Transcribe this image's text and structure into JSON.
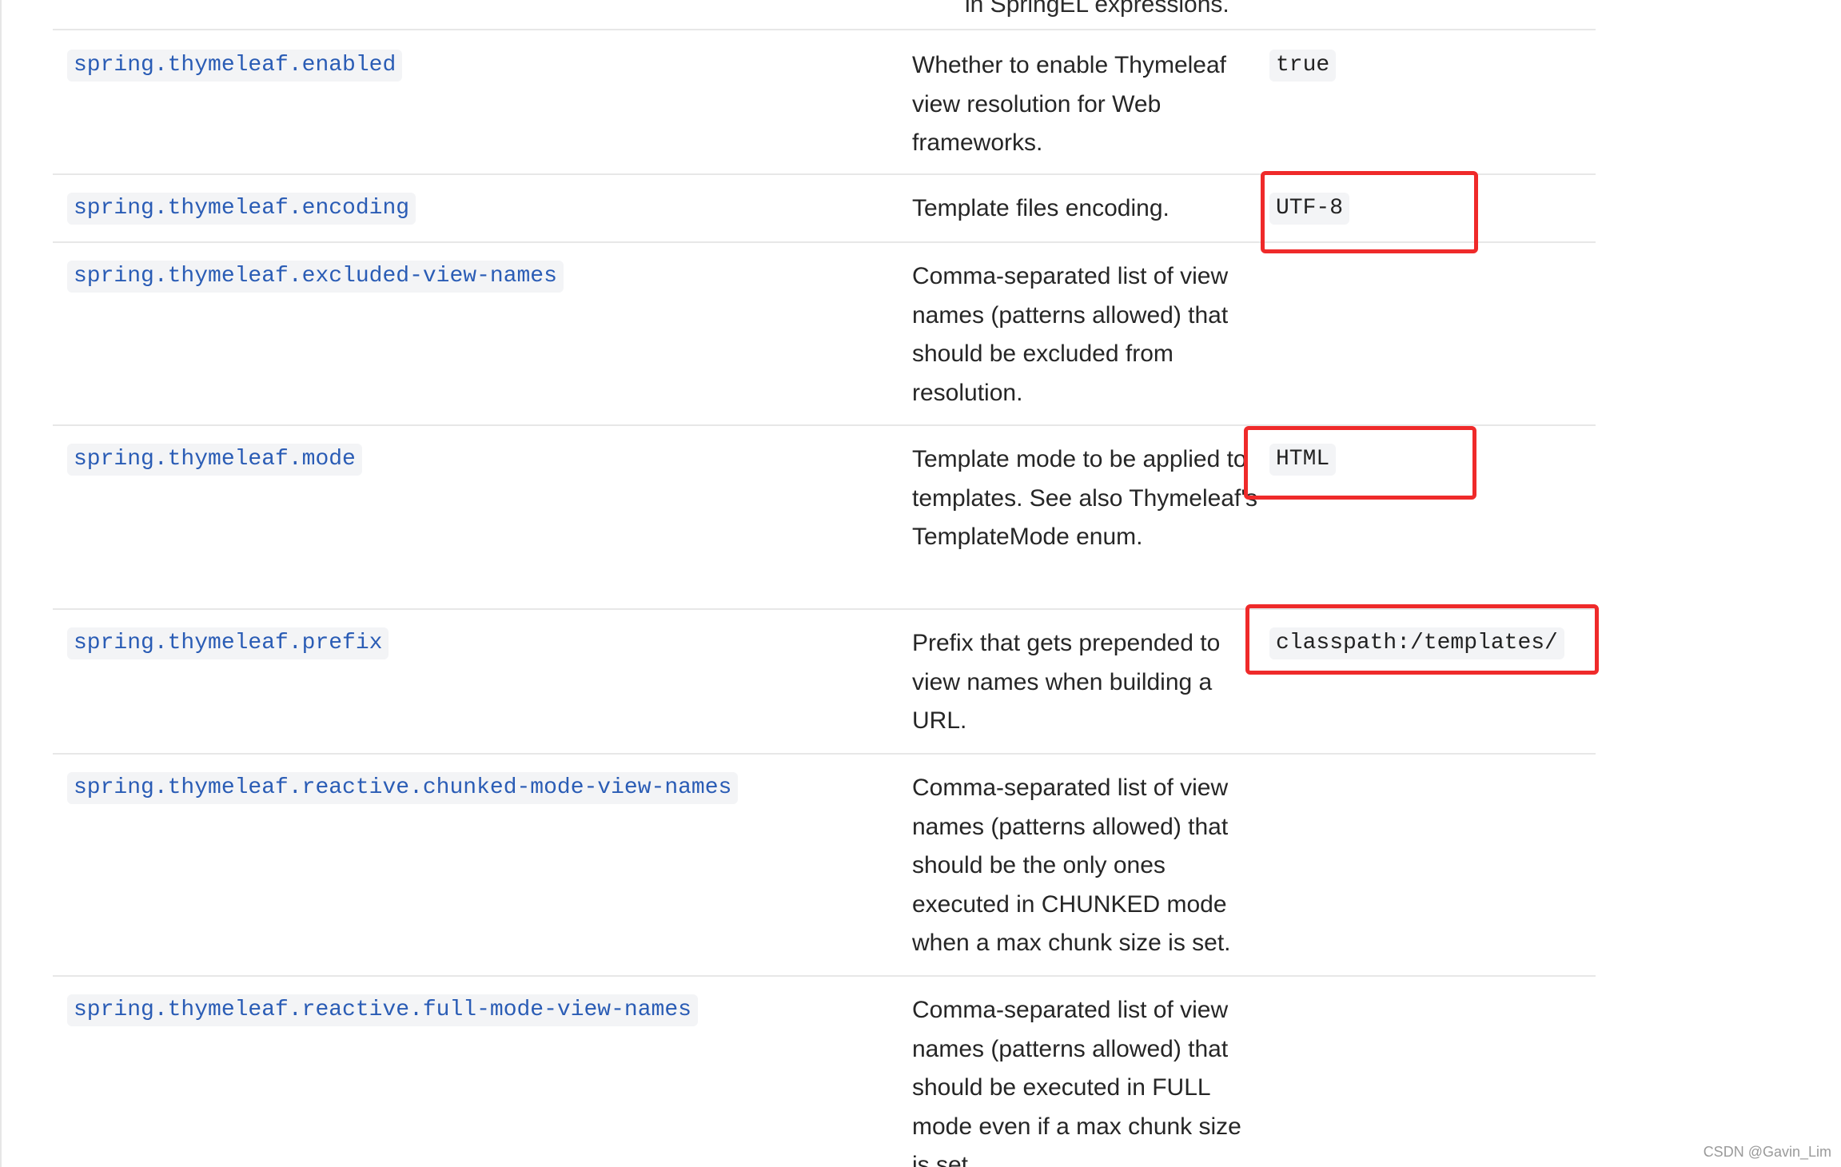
{
  "top_cutoff_text": "in SpringEL expressions.",
  "rows": [
    {
      "key": "spring.thymeleaf.enabled",
      "description": "Whether to enable Thymeleaf view resolution for Web frameworks.",
      "default": "true"
    },
    {
      "key": "spring.thymeleaf.encoding",
      "description": "Template files encoding.",
      "default": "UTF-8"
    },
    {
      "key": "spring.thymeleaf.excluded-view-names",
      "description": "Comma-separated list of view names (patterns allowed) that should be excluded from resolution.",
      "default": ""
    },
    {
      "key": "spring.thymeleaf.mode",
      "description": "Template mode to be applied to templates. See also Thymeleaf's TemplateMode enum.",
      "default": "HTML"
    },
    {
      "key": "spring.thymeleaf.prefix",
      "description": "Prefix that gets prepended to view names when building a URL.",
      "default": "classpath:/templates/"
    },
    {
      "key": "spring.thymeleaf.reactive.chunked-mode-view-names",
      "description": "Comma-separated list of view names (patterns allowed) that should be the only ones executed in CHUNKED mode when a max chunk size is set.",
      "default": ""
    },
    {
      "key": "spring.thymeleaf.reactive.full-mode-view-names",
      "description": "Comma-separated list of view names (patterns allowed) that should be executed in FULL mode even if a max chunk size is set.",
      "default": ""
    }
  ],
  "highlight_color": "#ef2a2a",
  "link_color": "#2a5cb5",
  "watermark": "CSDN @Gavin_Lim"
}
